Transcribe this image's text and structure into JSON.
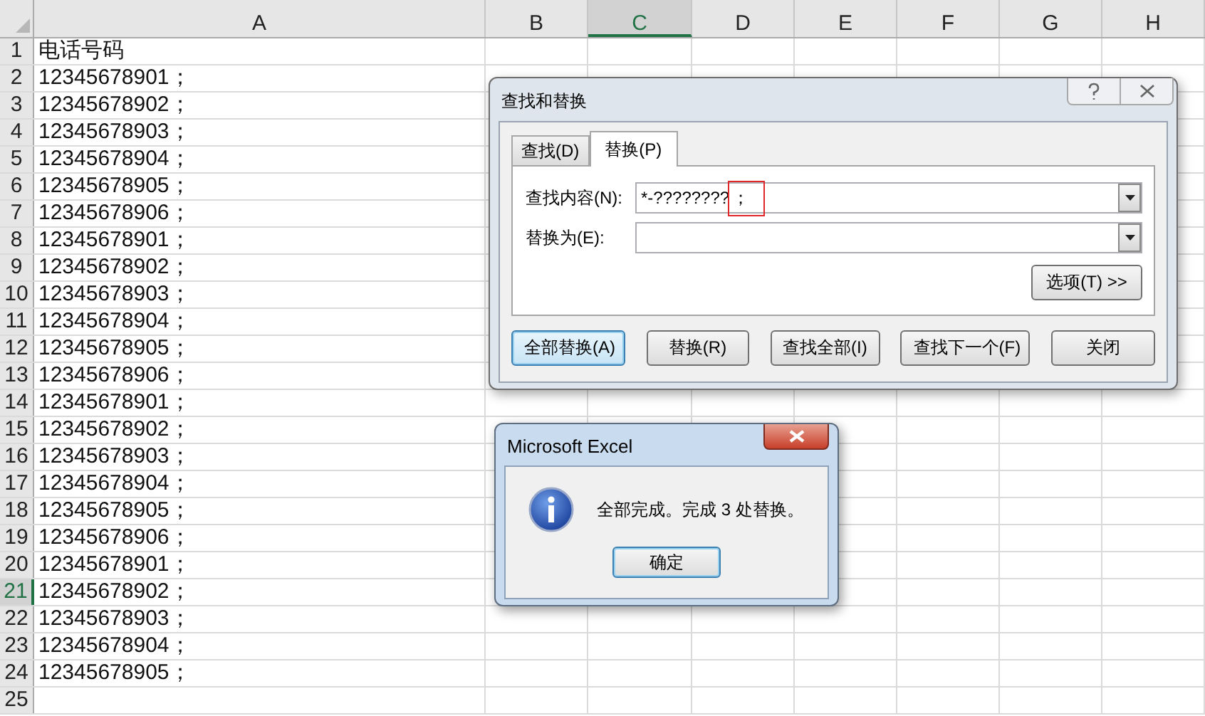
{
  "sheet": {
    "columns": [
      {
        "label": "A",
        "selected": false
      },
      {
        "label": "B",
        "selected": false
      },
      {
        "label": "C",
        "selected": true
      },
      {
        "label": "D",
        "selected": false
      },
      {
        "label": "E",
        "selected": false
      },
      {
        "label": "F",
        "selected": false
      },
      {
        "label": "G",
        "selected": false
      },
      {
        "label": "H",
        "selected": false
      }
    ],
    "rows": [
      {
        "label": "1",
        "selected": false,
        "cells": [
          "电话号码"
        ]
      },
      {
        "label": "2",
        "selected": false,
        "cells": [
          "12345678901；"
        ]
      },
      {
        "label": "3",
        "selected": false,
        "cells": [
          "12345678902；"
        ]
      },
      {
        "label": "4",
        "selected": false,
        "cells": [
          "12345678903；"
        ]
      },
      {
        "label": "5",
        "selected": false,
        "cells": [
          "12345678904；"
        ]
      },
      {
        "label": "6",
        "selected": false,
        "cells": [
          "12345678905；"
        ]
      },
      {
        "label": "7",
        "selected": false,
        "cells": [
          "12345678906；"
        ]
      },
      {
        "label": "8",
        "selected": false,
        "cells": [
          "12345678901；"
        ]
      },
      {
        "label": "9",
        "selected": false,
        "cells": [
          "12345678902；"
        ]
      },
      {
        "label": "10",
        "selected": false,
        "cells": [
          "12345678903；"
        ]
      },
      {
        "label": "11",
        "selected": false,
        "cells": [
          "12345678904；"
        ]
      },
      {
        "label": "12",
        "selected": false,
        "cells": [
          "12345678905；"
        ]
      },
      {
        "label": "13",
        "selected": false,
        "cells": [
          "12345678906；"
        ]
      },
      {
        "label": "14",
        "selected": false,
        "cells": [
          "12345678901；"
        ]
      },
      {
        "label": "15",
        "selected": false,
        "cells": [
          "12345678902；"
        ]
      },
      {
        "label": "16",
        "selected": false,
        "cells": [
          "12345678903；"
        ]
      },
      {
        "label": "17",
        "selected": false,
        "cells": [
          "12345678904；"
        ]
      },
      {
        "label": "18",
        "selected": false,
        "cells": [
          "12345678905；"
        ]
      },
      {
        "label": "19",
        "selected": false,
        "cells": [
          "12345678906；"
        ]
      },
      {
        "label": "20",
        "selected": false,
        "cells": [
          "12345678901；"
        ]
      },
      {
        "label": "21",
        "selected": true,
        "cells": [
          "12345678902；"
        ]
      },
      {
        "label": "22",
        "selected": false,
        "cells": [
          "12345678903；"
        ]
      },
      {
        "label": "23",
        "selected": false,
        "cells": [
          "12345678904；"
        ]
      },
      {
        "label": "24",
        "selected": false,
        "cells": [
          "12345678905；"
        ]
      },
      {
        "label": "25",
        "selected": false,
        "cells": []
      }
    ]
  },
  "find_replace_dialog": {
    "title": "查找和替换",
    "tabs": [
      {
        "label": "查找(D)",
        "selected": false
      },
      {
        "label": "替换(P)",
        "selected": true
      }
    ],
    "find_label": "查找内容(N):",
    "find_value": "*-????????",
    "find_highlight": "；",
    "replace_label": "替换为(E):",
    "options_button": "选项(T) >>",
    "buttons": [
      {
        "label": "全部替换(A)",
        "default": true
      },
      {
        "label": "替换(R)",
        "default": false
      },
      {
        "label": "查找全部(I)",
        "default": false
      },
      {
        "label": "查找下一个(F)",
        "default": false
      },
      {
        "label": "关闭",
        "default": false
      }
    ]
  },
  "alert": {
    "title": "Microsoft Excel",
    "message": "全部完成。完成 3 处替换。",
    "button": "确定"
  }
}
